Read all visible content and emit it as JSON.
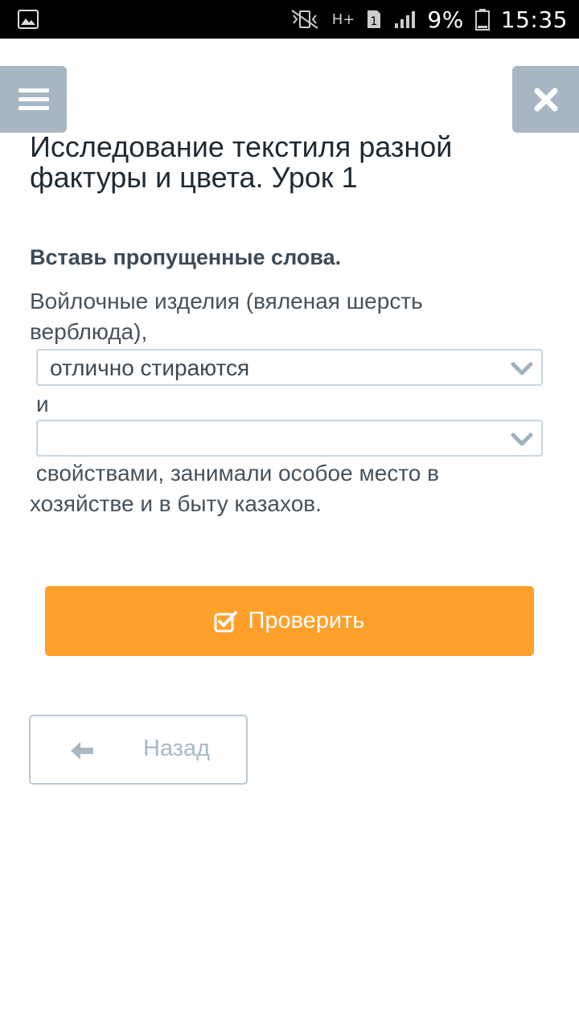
{
  "status_bar": {
    "battery": "9%",
    "time": "15:35",
    "network": "H+"
  },
  "header": {
    "menu_icon": "hamburger-menu-icon",
    "close_icon": "close-icon"
  },
  "lesson": {
    "title": "Исследование текстиля разной фактуры и цвета. Урок 1"
  },
  "task": {
    "instruction": "Вставь пропущенные слова.",
    "text_before": "Войлочные изделия (вяленая шерсть верблюда),",
    "select1_value": "отлично стираются",
    "connector": "и",
    "select2_value": "",
    "text_after": " свойствами, занимали особое место в хозяйстве и в быту казахов."
  },
  "actions": {
    "check_label": "Проверить",
    "back_label": "Назад"
  },
  "colors": {
    "accent": "#ffa02b",
    "header_button": "#a7b6c2",
    "muted": "#a8b9c5"
  }
}
